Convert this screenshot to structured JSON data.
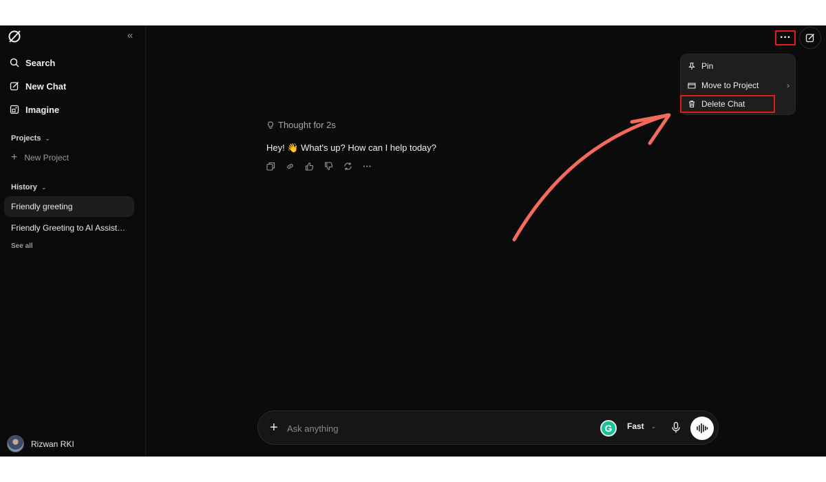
{
  "sidebar": {
    "nav": [
      {
        "label": "Search",
        "icon": "search-icon"
      },
      {
        "label": "New Chat",
        "icon": "edit-icon"
      },
      {
        "label": "Imagine",
        "icon": "image-icon"
      }
    ],
    "projects_label": "Projects",
    "new_project_label": "New Project",
    "history_label": "History",
    "history": [
      {
        "label": "Friendly greeting",
        "active": true
      },
      {
        "label": "Friendly Greeting to AI Assist…",
        "active": false
      }
    ],
    "see_all_label": "See all",
    "user_name": "Rizwan RKI"
  },
  "header": {
    "more_icon": "ellipsis-icon",
    "edit_icon": "edit-icon"
  },
  "menu": {
    "items": [
      {
        "label": "Pin",
        "icon": "pin-icon"
      },
      {
        "label": "Move to Project",
        "icon": "folder-icon"
      },
      {
        "label": "Delete Chat",
        "icon": "trash-icon"
      }
    ]
  },
  "chat": {
    "thought_label": "Thought for 2s",
    "message": "Hey! 👋 What's up? How can I help today?"
  },
  "composer": {
    "placeholder": "Ask anything",
    "mode_label": "Fast"
  },
  "colors": {
    "background": "#0b0b0b",
    "highlight": "#e01b1b",
    "annotation_arrow": "#f26b5b"
  }
}
